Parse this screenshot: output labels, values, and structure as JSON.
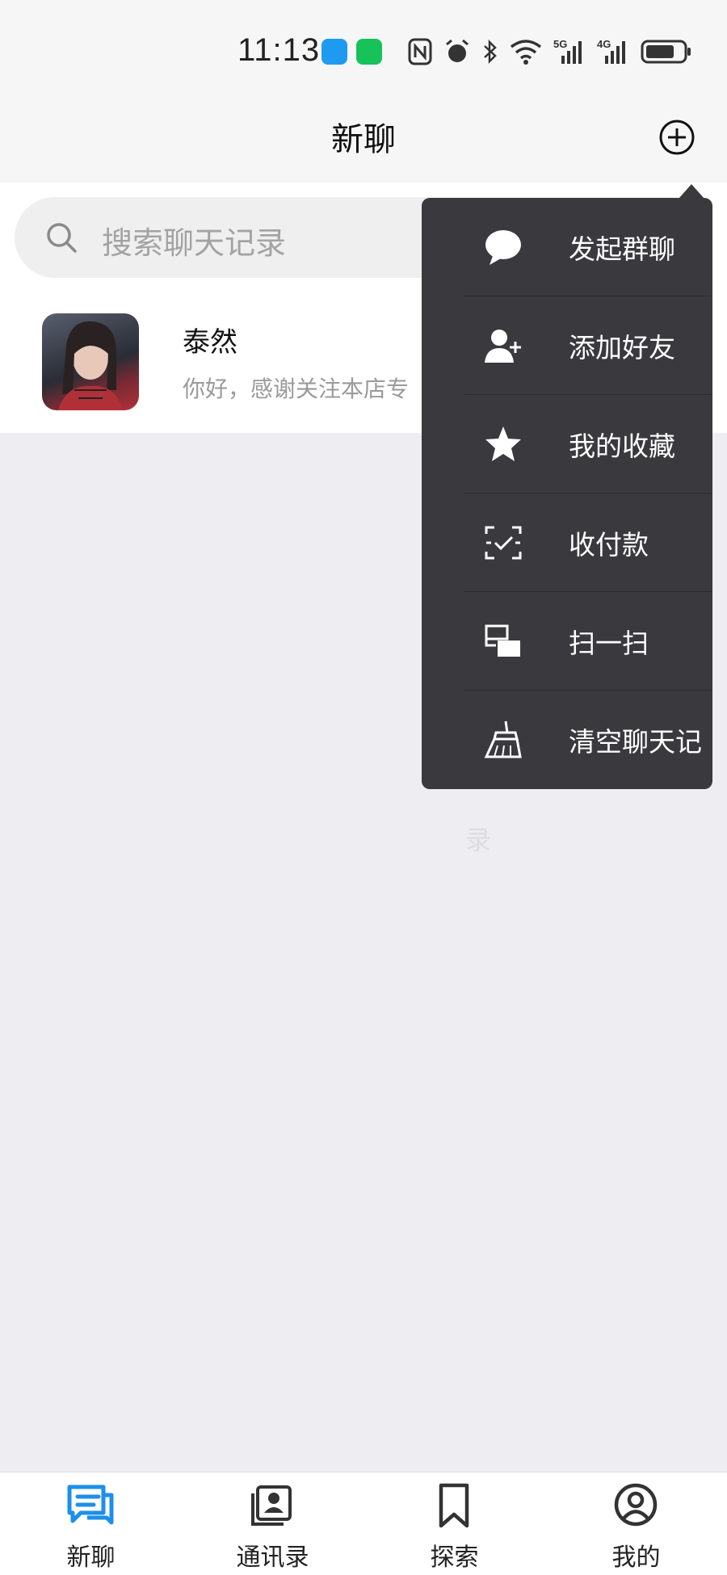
{
  "status_bar": {
    "time": "11:13",
    "network_5g": "5G",
    "network_4g": "4G"
  },
  "header": {
    "title": "新聊"
  },
  "search": {
    "placeholder": "搜索聊天记录"
  },
  "chats": [
    {
      "name": "泰然",
      "preview": "你好，感谢关注本店专"
    }
  ],
  "menu": {
    "items": [
      {
        "label": "发起群聊",
        "icon": "chat-bubble-icon"
      },
      {
        "label": "添加好友",
        "icon": "add-friend-icon"
      },
      {
        "label": "我的收藏",
        "icon": "star-icon"
      },
      {
        "label": "收付款",
        "icon": "payment-scan-icon"
      },
      {
        "label": "扫一扫",
        "icon": "scan-icon"
      },
      {
        "label": "清空聊天记",
        "icon": "broom-icon"
      }
    ]
  },
  "faint_text": "录",
  "tabs": [
    {
      "label": "新聊",
      "icon": "chat-tab-icon",
      "active": true
    },
    {
      "label": "通讯录",
      "icon": "contacts-icon",
      "active": false
    },
    {
      "label": "探索",
      "icon": "bookmark-icon",
      "active": false
    },
    {
      "label": "我的",
      "icon": "profile-icon",
      "active": false
    }
  ],
  "colors": {
    "accent": "#1e8fe8",
    "menu_bg": "#3a3a3e",
    "page_bg": "#eeedf2"
  }
}
